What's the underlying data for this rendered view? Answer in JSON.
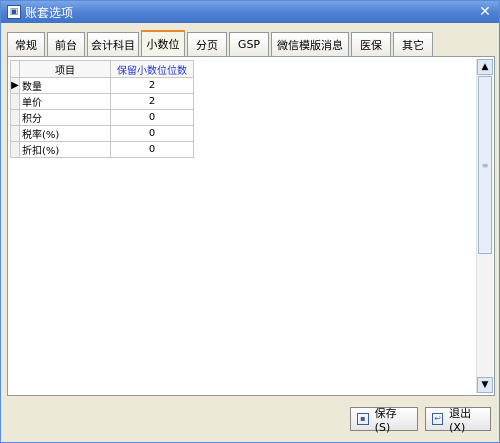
{
  "window": {
    "title": "账套选项"
  },
  "tabs": [
    {
      "label": "常规",
      "active": false
    },
    {
      "label": "前台",
      "active": false
    },
    {
      "label": "会计科目",
      "active": false
    },
    {
      "label": "小数位",
      "active": true
    },
    {
      "label": "分页",
      "active": false
    },
    {
      "label": "GSP",
      "active": false
    },
    {
      "label": "微信模版消息",
      "active": false
    },
    {
      "label": "医保",
      "active": false
    },
    {
      "label": "其它",
      "active": false
    }
  ],
  "grid": {
    "columns": [
      "项目",
      "保留小数位位数"
    ],
    "rows": [
      {
        "item": "数量",
        "value": "2",
        "current": true
      },
      {
        "item": "单价",
        "value": "2",
        "current": false
      },
      {
        "item": "积分",
        "value": "0",
        "current": false
      },
      {
        "item": "税率(%)",
        "value": "0",
        "current": false
      },
      {
        "item": "折扣(%)",
        "value": "0",
        "current": false
      }
    ]
  },
  "buttons": {
    "save": "保存(S)",
    "exit": "退出(X)"
  }
}
